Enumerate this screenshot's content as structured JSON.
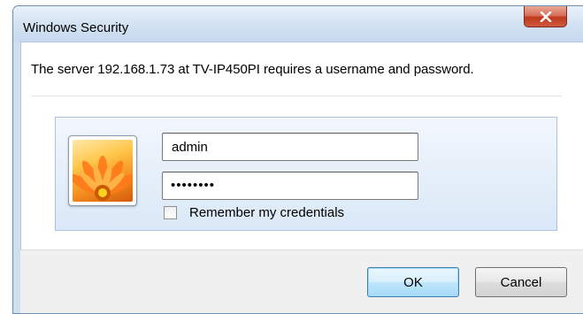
{
  "window": {
    "title": "Windows Security",
    "close_label": "X"
  },
  "prompt": {
    "message": "The server 192.168.1.73 at TV-IP450PI requires a username and password."
  },
  "credentials": {
    "username": "admin",
    "password_mask": "••••••••",
    "remember_label": "Remember my credentials",
    "remember_checked": false
  },
  "buttons": {
    "ok_label": "OK",
    "cancel_label": "Cancel"
  },
  "icons": {
    "close": "close-icon",
    "user_tile": "user-tile-flower-icon"
  },
  "colors": {
    "close_button": "#c0391d",
    "panel_border": "#a9c3e0",
    "ok_button_border": "#3c7fb1"
  }
}
